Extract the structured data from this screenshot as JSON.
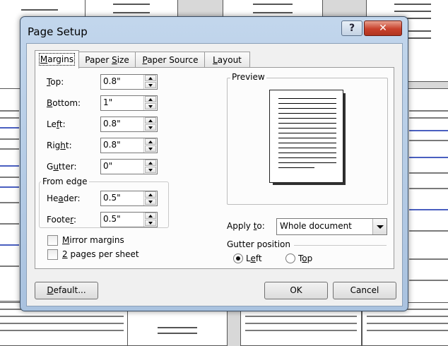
{
  "window": {
    "title": "Page Setup",
    "help_label": "?",
    "close_label": "✕"
  },
  "tabs": [
    {
      "pre": "",
      "key": "M",
      "post": "argins",
      "active": true
    },
    {
      "pre": "Paper ",
      "key": "S",
      "post": "ize",
      "active": false
    },
    {
      "pre": "",
      "key": "P",
      "post": "aper Source",
      "active": false
    },
    {
      "pre": "",
      "key": "L",
      "post": "ayout",
      "active": false
    }
  ],
  "margins": {
    "top": {
      "pre": "",
      "key": "T",
      "post": "op:",
      "value": "0.8\""
    },
    "bottom": {
      "pre": "",
      "key": "B",
      "post": "ottom:",
      "value": "1\""
    },
    "left": {
      "pre": "Le",
      "key": "f",
      "post": "t:",
      "value": "0.8\""
    },
    "right": {
      "pre": "Rig",
      "key": "h",
      "post": "t:",
      "value": "0.8\""
    },
    "gutter": {
      "pre": "G",
      "key": "u",
      "post": "tter:",
      "value": "0\""
    }
  },
  "from_edge": {
    "title": "From edge",
    "header": {
      "pre": "He",
      "key": "a",
      "post": "der:",
      "value": "0.5\""
    },
    "footer": {
      "pre": "Foote",
      "key": "r",
      "post": ":",
      "value": "0.5\""
    }
  },
  "checkboxes": {
    "mirror": {
      "pre": "",
      "key": "M",
      "post": "irror margins"
    },
    "two_pages": {
      "pre": "",
      "key": "2",
      "post": " pages per sheet"
    }
  },
  "preview": {
    "title": "Preview"
  },
  "apply_to": {
    "pre": "Apply ",
    "key": "t",
    "post": "o:",
    "value": "Whole document"
  },
  "gutter_position": {
    "title": "Gutter position",
    "left": {
      "pre": "L",
      "key": "e",
      "post": "ft",
      "selected": true
    },
    "top": {
      "pre": "T",
      "key": "o",
      "post": "p",
      "selected": false
    }
  },
  "buttons": {
    "default": {
      "pre": "",
      "key": "D",
      "post": "efault..."
    },
    "ok": "OK",
    "cancel": "Cancel"
  }
}
